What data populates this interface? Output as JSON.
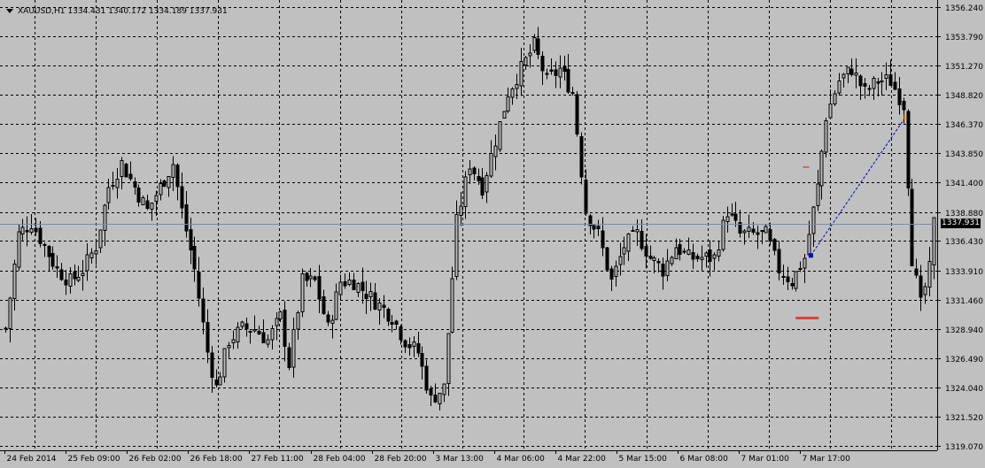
{
  "header": {
    "symbol": "XAUUSD,H1",
    "ohlc": "1334.431 1340.172 1334.189 1337.931"
  },
  "current_price_label": "1337.931",
  "colors": {
    "background": "#c0c0c0",
    "grid": "#000000",
    "candle": "#000000",
    "trendline": "#0000cc",
    "stop_marker": "#e04040",
    "entry_marker": "#0000cc",
    "exit_marker": "#ffa500"
  },
  "chart_data": {
    "type": "candlestick",
    "title": "",
    "xlabel": "",
    "ylabel": "",
    "grid": true,
    "ylim": [
      1319.07,
      1356.24
    ],
    "y_ticks": [
      "1356.240",
      "1353.790",
      "1351.270",
      "1348.820",
      "1346.370",
      "1343.850",
      "1341.400",
      "1338.880",
      "1336.430",
      "1333.910",
      "1331.460",
      "1328.940",
      "1326.490",
      "1324.040",
      "1321.520",
      "1319.070"
    ],
    "x_ticks": [
      "24 Feb 2014",
      "25 Feb 09:00",
      "26 Feb 02:00",
      "26 Feb 18:00",
      "27 Feb 11:00",
      "28 Feb 04:00",
      "28 Feb 20:00",
      "3 Mar 13:00",
      "4 Mar 06:00",
      "4 Mar 22:00",
      "5 Mar 15:00",
      "6 Mar 08:00",
      "7 Mar 01:00",
      "7 Mar 17:00"
    ],
    "current_price": 1337.931,
    "guide_points": [
      [
        0,
        1329
      ],
      [
        3,
        1337
      ],
      [
        6,
        1338
      ],
      [
        9,
        1336
      ],
      [
        12,
        1334
      ],
      [
        15,
        1333
      ],
      [
        18,
        1334
      ],
      [
        21,
        1336
      ],
      [
        24,
        1341
      ],
      [
        27,
        1343
      ],
      [
        30,
        1341
      ],
      [
        33,
        1339
      ],
      [
        36,
        1341
      ],
      [
        39,
        1343
      ],
      [
        41,
        1339
      ],
      [
        44,
        1334
      ],
      [
        47,
        1327
      ],
      [
        49,
        1324
      ],
      [
        52,
        1328
      ],
      [
        55,
        1329
      ],
      [
        58,
        1329
      ],
      [
        61,
        1328
      ],
      [
        64,
        1330
      ],
      [
        66,
        1326
      ],
      [
        69,
        1333
      ],
      [
        72,
        1333
      ],
      [
        75,
        1329
      ],
      [
        78,
        1333
      ],
      [
        81,
        1333
      ],
      [
        84,
        1332
      ],
      [
        87,
        1331
      ],
      [
        90,
        1330
      ],
      [
        93,
        1328
      ],
      [
        96,
        1327
      ],
      [
        99,
        1323
      ],
      [
        102,
        1324
      ],
      [
        105,
        1338
      ],
      [
        108,
        1343
      ],
      [
        111,
        1341
      ],
      [
        114,
        1345
      ],
      [
        117,
        1349
      ],
      [
        120,
        1351
      ],
      [
        123,
        1353
      ],
      [
        126,
        1350
      ],
      [
        129,
        1351
      ],
      [
        132,
        1349
      ],
      [
        135,
        1339
      ],
      [
        138,
        1337
      ],
      [
        141,
        1333
      ],
      [
        144,
        1336
      ],
      [
        147,
        1337
      ],
      [
        150,
        1335
      ],
      [
        153,
        1334
      ],
      [
        156,
        1336
      ],
      [
        159,
        1335
      ],
      [
        162,
        1335
      ],
      [
        165,
        1335
      ],
      [
        168,
        1339
      ],
      [
        171,
        1337
      ],
      [
        174,
        1337
      ],
      [
        177,
        1337
      ],
      [
        180,
        1334
      ],
      [
        183,
        1333
      ],
      [
        186,
        1335
      ],
      [
        189,
        1341
      ],
      [
        191,
        1347
      ],
      [
        194,
        1350
      ],
      [
        197,
        1351
      ],
      [
        200,
        1349
      ],
      [
        203,
        1350
      ],
      [
        206,
        1350
      ],
      [
        209,
        1348
      ],
      [
        211,
        1335
      ],
      [
        213,
        1331
      ],
      [
        215,
        1334
      ],
      [
        216,
        1337.931
      ]
    ],
    "markers": [
      {
        "kind": "entry",
        "bar_index": 187.5,
        "price": 1335.2
      },
      {
        "kind": "exit",
        "bar_index": 209.5,
        "price": 1346.9
      },
      {
        "kind": "stop",
        "bar_index": 185,
        "price": 1329.9
      },
      {
        "kind": "target",
        "bar_index": 186.5,
        "price": 1342.7
      }
    ]
  }
}
